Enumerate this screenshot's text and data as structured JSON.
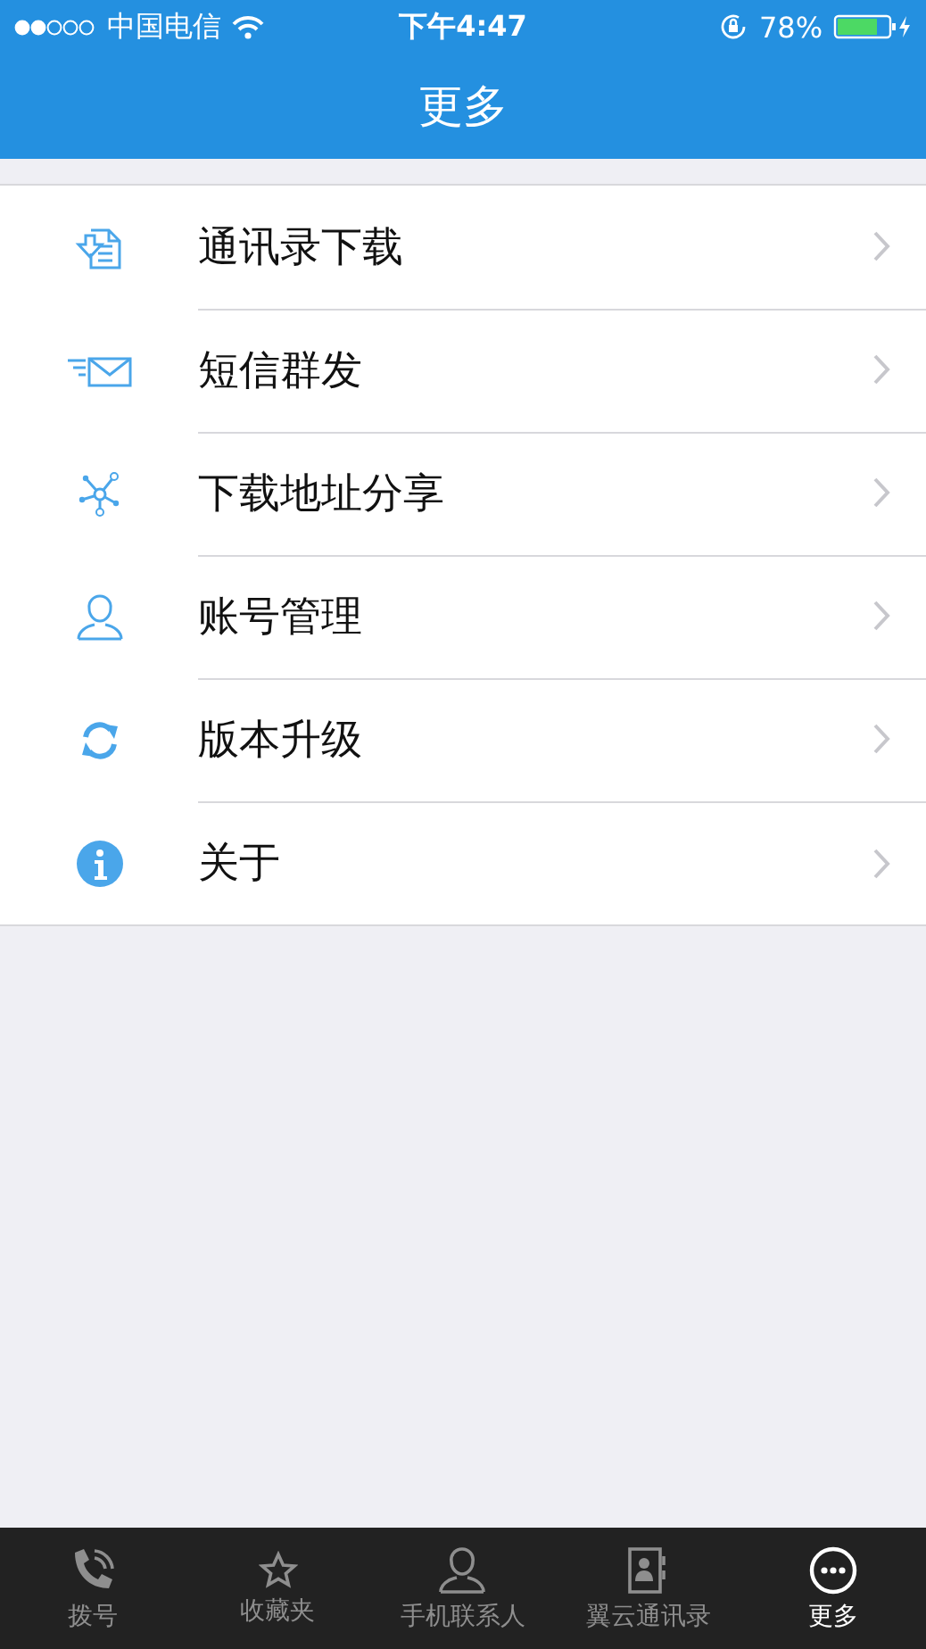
{
  "status_bar": {
    "carrier": "中国电信",
    "time": "下午4:47",
    "battery": "78%"
  },
  "nav_bar": {
    "title": "更多"
  },
  "menu": [
    {
      "kind": "download",
      "label": "通讯录下载"
    },
    {
      "kind": "sms",
      "label": "短信群发"
    },
    {
      "kind": "share",
      "label": "下载地址分享"
    },
    {
      "kind": "account",
      "label": "账号管理"
    },
    {
      "kind": "upgrade",
      "label": "版本升级"
    },
    {
      "kind": "about",
      "label": "关于"
    }
  ],
  "tab_bar": [
    {
      "kind": "dial",
      "label": "拨号",
      "selected": false
    },
    {
      "kind": "favorites",
      "label": "收藏夹",
      "selected": false
    },
    {
      "kind": "contacts",
      "label": "手机联系人",
      "selected": false
    },
    {
      "kind": "cloud",
      "label": "翼云通讯录",
      "selected": false
    },
    {
      "kind": "more",
      "label": "更多",
      "selected": true
    }
  ]
}
